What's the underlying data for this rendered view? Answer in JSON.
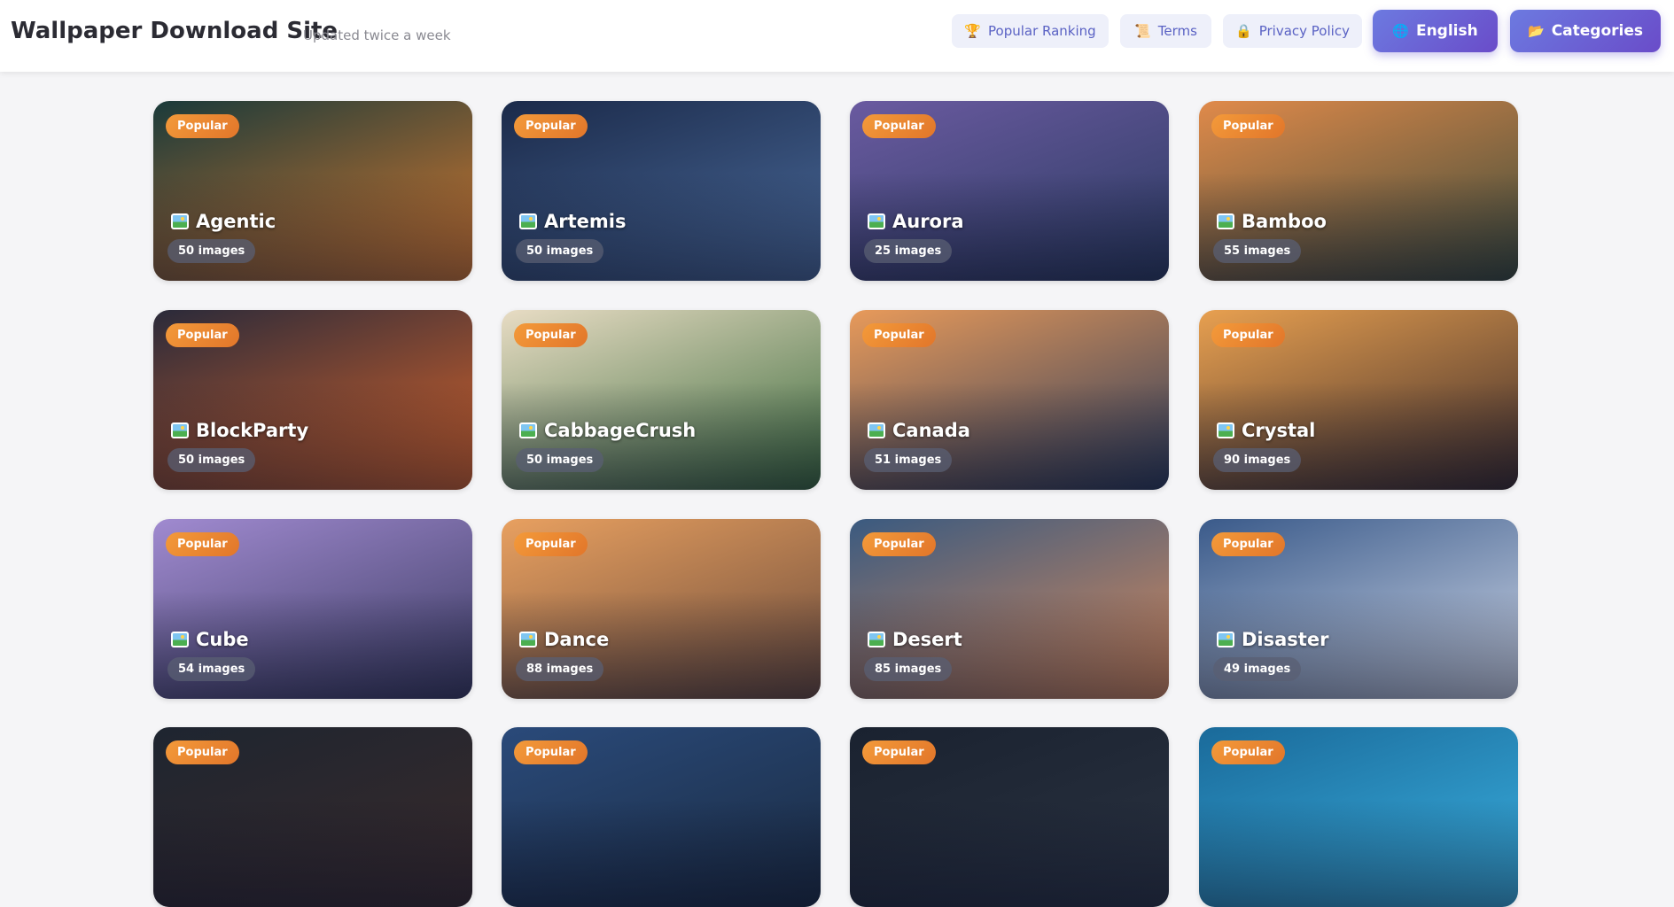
{
  "header": {
    "title": "Wallpaper Download Site",
    "subtitle": "Updated twice a week",
    "nav": [
      {
        "label": "Popular Ranking",
        "icon": "trophy-icon",
        "glyph": "🏆"
      },
      {
        "label": "Terms",
        "icon": "scroll-icon",
        "glyph": "📜"
      },
      {
        "label": "Privacy Policy",
        "icon": "lock-icon",
        "glyph": "🔒"
      },
      {
        "label": "English",
        "icon": "globe-icon",
        "glyph": "🌐"
      },
      {
        "label": "Categories",
        "icon": "folder-icon",
        "glyph": "📂"
      }
    ]
  },
  "cards": [
    {
      "badge": "Popular",
      "title": "Agentic",
      "count": "50 images",
      "colors": [
        "#1a3a3a",
        "#d97a2e"
      ]
    },
    {
      "badge": "Popular",
      "title": "Artemis",
      "count": "50 images",
      "colors": [
        "#1b2a4a",
        "#4a6a9a"
      ]
    },
    {
      "badge": "Popular",
      "title": "Aurora",
      "count": "25 images",
      "colors": [
        "#6a5aa0",
        "#2a3a60"
      ]
    },
    {
      "badge": "Popular",
      "title": "Bamboo",
      "count": "55 images",
      "colors": [
        "#e08a4a",
        "#3a4a3a"
      ]
    },
    {
      "badge": "Popular",
      "title": "BlockParty",
      "count": "50 images",
      "colors": [
        "#2a2a3a",
        "#d8642a"
      ]
    },
    {
      "badge": "Popular",
      "title": "CabbageCrush",
      "count": "50 images",
      "colors": [
        "#e8dcc4",
        "#3a6a3a"
      ]
    },
    {
      "badge": "Popular",
      "title": "Canada",
      "count": "51 images",
      "colors": [
        "#e89a5a",
        "#2a3a5a"
      ]
    },
    {
      "badge": "Popular",
      "title": "Crystal",
      "count": "90 images",
      "colors": [
        "#e8a050",
        "#3a2a2a"
      ]
    },
    {
      "badge": "Popular",
      "title": "Cube",
      "count": "54 images",
      "colors": [
        "#a08ad0",
        "#3a3a60"
      ]
    },
    {
      "badge": "Popular",
      "title": "Dance",
      "count": "88 images",
      "colors": [
        "#e8a060",
        "#6a4a3a"
      ]
    },
    {
      "badge": "Popular",
      "title": "Desert",
      "count": "85 images",
      "colors": [
        "#3a5a80",
        "#d88a5a"
      ]
    },
    {
      "badge": "Popular",
      "title": "Disaster",
      "count": "49 images",
      "colors": [
        "#3a5a8a",
        "#d0d8e8"
      ]
    },
    {
      "badge": "Popular",
      "title": "",
      "count": "",
      "colors": [
        "#1e2530",
        "#3a2a2a"
      ]
    },
    {
      "badge": "Popular",
      "title": "",
      "count": "",
      "colors": [
        "#2a4a7a",
        "#1a2a40"
      ]
    },
    {
      "badge": "Popular",
      "title": "",
      "count": "",
      "colors": [
        "#1a2230",
        "#2a3240"
      ]
    },
    {
      "badge": "Popular",
      "title": "",
      "count": "",
      "colors": [
        "#1a6a9a",
        "#3ab0e0"
      ]
    }
  ]
}
